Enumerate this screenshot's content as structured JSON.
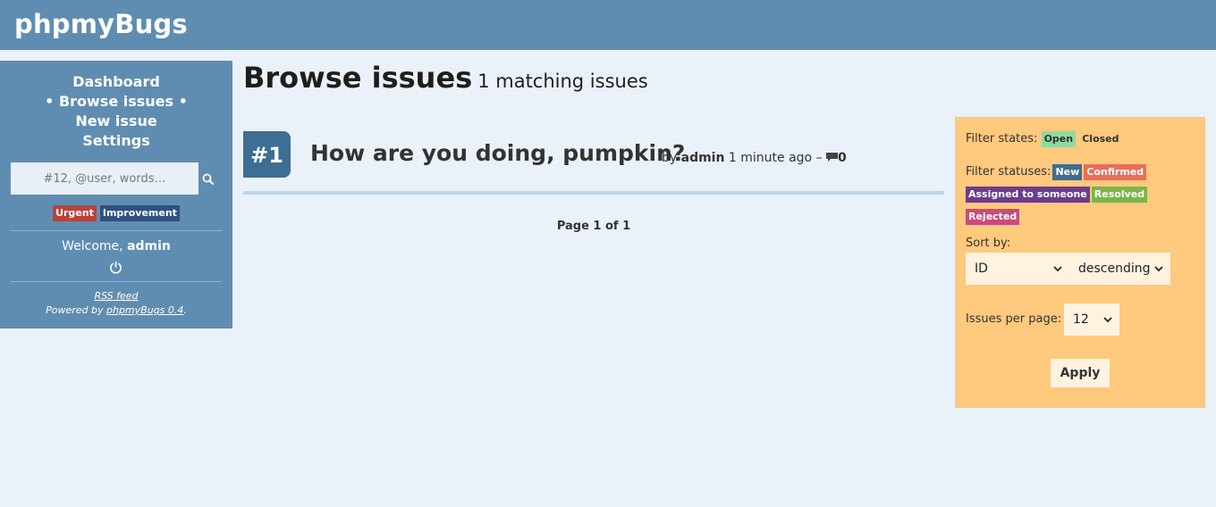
{
  "app": {
    "title": "phpmyBugs"
  },
  "sidebar": {
    "nav": [
      {
        "label": "Dashboard"
      },
      {
        "label": "• Browse issues •"
      },
      {
        "label": "New issue"
      },
      {
        "label": "Settings"
      }
    ],
    "search": {
      "placeholder": "#12, @user, words…",
      "icon": "search-icon"
    },
    "tags": [
      {
        "label": "Urgent",
        "color": "#b8423c"
      },
      {
        "label": "Improvement",
        "color": "#2e5080"
      }
    ],
    "welcome_prefix": "Welcome,",
    "username": "admin",
    "footer": {
      "rss": "RSS feed",
      "powered_prefix": "Powered by",
      "powered_link": "phpmyBugs 0.4",
      "powered_suffix": "."
    }
  },
  "main": {
    "title": "Browse issues",
    "matching": "1 matching issues",
    "issues": [
      {
        "id": "#1",
        "title": "How are you doing, pumpkin?",
        "by_label": "by",
        "author": "admin",
        "time": "1 minute ago –",
        "comments": "0"
      }
    ],
    "pager": "Page 1 of 1"
  },
  "filters": {
    "states_label": "Filter states:",
    "states": [
      {
        "label": "Open",
        "color": "#8fd9a0",
        "text": "#333333"
      },
      {
        "label": "Closed",
        "color": "#ffc97e",
        "text": "#333333"
      }
    ],
    "statuses_label": "Filter statuses:",
    "statuses": [
      {
        "label": "New",
        "color": "#3e6e93"
      },
      {
        "label": "Confirmed",
        "color": "#e86e5a"
      },
      {
        "label": "Assigned to someone",
        "color": "#6a3c8e"
      },
      {
        "label": "Resolved",
        "color": "#7ab648"
      },
      {
        "label": "Rejected",
        "color": "#c84b7a"
      }
    ],
    "sort_label": "Sort by:",
    "sort_field": "ID",
    "sort_order": "descending",
    "per_page_label": "Issues per page:",
    "per_page": "12",
    "apply_label": "Apply"
  }
}
